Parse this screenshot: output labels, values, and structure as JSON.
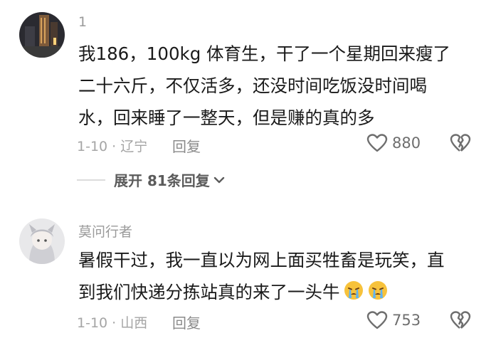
{
  "comments": [
    {
      "username": "1",
      "lines": [
        "我186，100kg 体育生，干了一个星期回来瘦了",
        "二十六斤，不仅活多，还没时间吃饭没时间喝",
        "水，回来睡了一整天，但是赚的真的多"
      ],
      "date_location": "1-10 · 辽宁",
      "reply_label": "回复",
      "likes": "880",
      "expand_replies": "展开 81条回复"
    },
    {
      "username": "莫问行者",
      "lines": [
        "暑假干过，我一直以为网上面买牲畜是玩笑，直",
        "到我们快递分拣站真的来了一头牛"
      ],
      "date_location": "1-10 · 山西",
      "reply_label": "回复",
      "likes": "753"
    }
  ],
  "icons": {
    "like": "heart-outline-icon",
    "dislike": "broken-heart-icon",
    "expand": "chevron-down-icon",
    "emoji": "crying-face-emoji-icon"
  }
}
